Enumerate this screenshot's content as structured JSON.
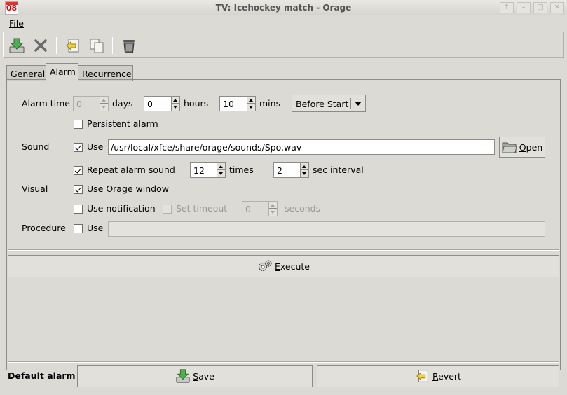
{
  "window": {
    "title": "TV: Icehockey match - Orage",
    "icon_number": "08",
    "controls": {
      "up": "↑",
      "minimize": "–",
      "maximize": "□",
      "close": "✕"
    }
  },
  "menu": {
    "file_label": "File"
  },
  "toolbar": {
    "save_close_icon": "save-close-icon",
    "close_icon": "close-icon",
    "revert_icon": "undo-icon",
    "duplicate_icon": "duplicate-icon",
    "delete_icon": "trash-icon"
  },
  "tabs": [
    {
      "label": "General",
      "active": false
    },
    {
      "label": "Alarm",
      "active": true
    },
    {
      "label": "Recurrence",
      "active": false
    }
  ],
  "alarm": {
    "alarm_time_label": "Alarm time",
    "days_value": "0",
    "days_label": "days",
    "hours_value": "0",
    "hours_label": "hours",
    "mins_value": "10",
    "mins_label": "mins",
    "when_value": "Before Start",
    "persistent_label": "Persistent alarm",
    "persistent_checked": false
  },
  "sound": {
    "label": "Sound",
    "use_label": "Use",
    "use_checked": true,
    "path": "/usr/local/xfce/share/orage/sounds/Spo.wav",
    "open_label": "Open",
    "repeat_label": "Repeat alarm sound",
    "repeat_checked": true,
    "times_value": "12",
    "times_label": "times",
    "interval_value": "2",
    "interval_label": "sec interval"
  },
  "visual": {
    "label": "Visual",
    "orage_window_label": "Use Orage window",
    "orage_window_checked": true,
    "notification_label": "Use notification",
    "notification_checked": false,
    "set_timeout_label": "Set timeout",
    "timeout_value": "0",
    "seconds_label": "seconds"
  },
  "procedure": {
    "label": "Procedure",
    "use_label": "Use",
    "command": ""
  },
  "execute_label": "Execute",
  "footer": {
    "default_alarm_label": "Default alarm",
    "save_label": "Save",
    "revert_label": "Revert"
  }
}
